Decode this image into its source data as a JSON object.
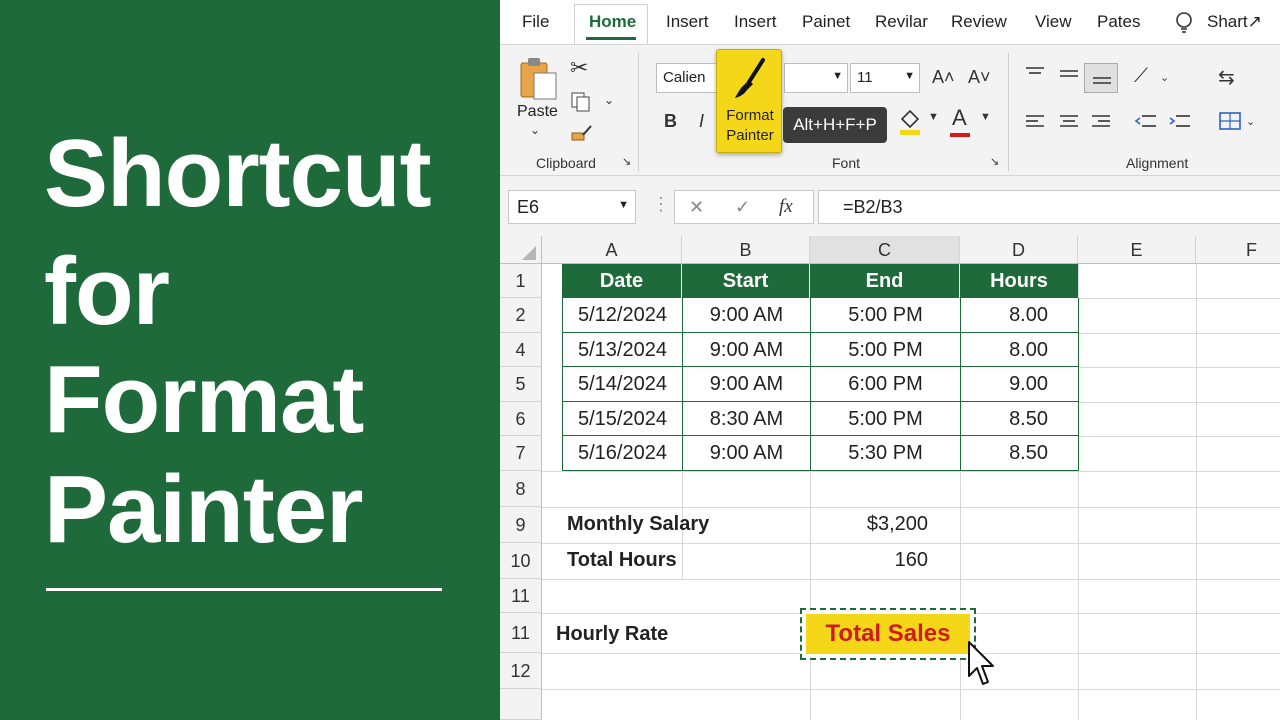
{
  "title": {
    "lines": [
      "Shortcut",
      "for",
      "Format",
      "Painter"
    ]
  },
  "tabs": [
    "File",
    "Home",
    "Insert",
    "Insert",
    "Painet",
    "Revilar",
    "Review",
    "View",
    "Pates"
  ],
  "tell_me": "Shart↗",
  "ribbon": {
    "clipboard": {
      "paste_label": "Paste",
      "group_label": "Clipboard"
    },
    "font": {
      "name": "Calien",
      "size": "11",
      "group_label": "Font",
      "format_painter_label": "Format\nPainter",
      "tooltip": "Alt+H+F+P",
      "bold": "B",
      "italic": "I",
      "grow": "A˄",
      "shrink": "A˅",
      "font_color_glyph": "A"
    },
    "alignment": {
      "group_label": "Alignment"
    }
  },
  "formula_bar": {
    "name_box": "E6",
    "formula": "=B2/B3",
    "fx": "fx",
    "cancel": "✕",
    "enter": "✓"
  },
  "grid": {
    "columns": [
      "A",
      "B",
      "C",
      "D",
      "E",
      "F"
    ],
    "rows": [
      "1",
      "2",
      "4",
      "5",
      "6",
      "7",
      "8",
      "9",
      "10",
      "11",
      "11",
      "12"
    ],
    "table_headers": [
      "Date",
      "Start",
      "End",
      "Hours"
    ],
    "table_rows": [
      [
        "5/12/2024",
        "9:00 AM",
        "5:00 PM",
        "8.00"
      ],
      [
        "5/13/2024",
        "9:00 AM",
        "5:00 PM",
        "8.00"
      ],
      [
        "5/14/2024",
        "9:00 AM",
        "6:00 PM",
        "9.00"
      ],
      [
        "5/15/2024",
        "8:30 AM",
        "5:00 PM",
        "8.50"
      ],
      [
        "5/16/2024",
        "9:00 AM",
        "5:30 PM",
        "8.50"
      ]
    ],
    "monthly_salary_label": "Monthly Salary",
    "monthly_salary_value": "$3,200",
    "total_hours_label": "Total Hours",
    "total_hours_value": "160",
    "hourly_rate_label": "Hourly Rate",
    "total_sales_label": "Total Sales"
  },
  "colors": {
    "green": "#1e6a3a",
    "yellow": "#f5d71a",
    "red": "#d11b1b"
  }
}
